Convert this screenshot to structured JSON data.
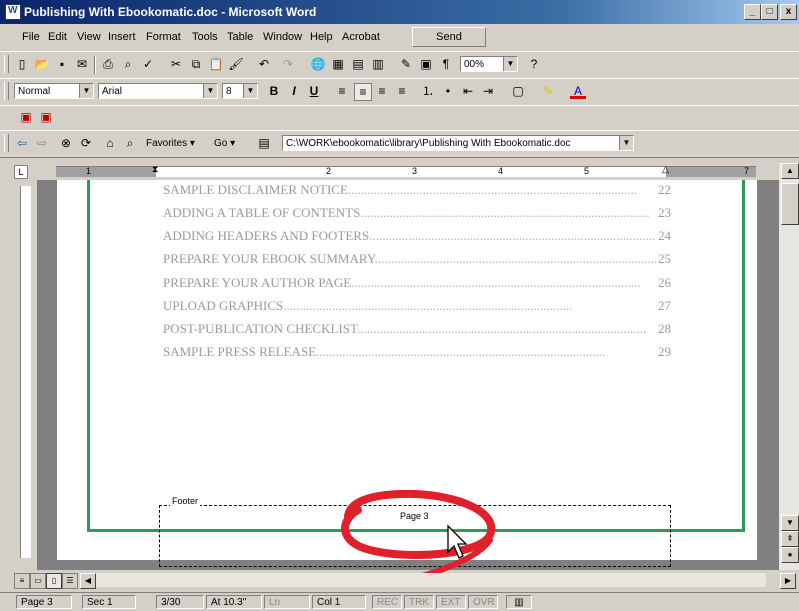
{
  "window": {
    "title": "Publishing With Ebookomatic.doc - Microsoft Word",
    "controls": [
      "_",
      "□",
      "x"
    ]
  },
  "menu": {
    "items": [
      "File",
      "Edit",
      "View",
      "Insert",
      "Format",
      "Tools",
      "Table",
      "Window",
      "Help",
      "Acrobat"
    ],
    "send_label": "Send"
  },
  "toolbar": {
    "zoom": "00%",
    "style": "Normal",
    "font": "Arial",
    "font_size": "8",
    "bold": "B",
    "italic": "I",
    "underline": "U"
  },
  "web_toolbar": {
    "favorites_label": "Favorites",
    "go_label": "Go",
    "address": "C:\\WORK\\ebookomatic\\library\\Publishing With Ebookomatic.doc"
  },
  "ruler": {
    "numbers": [
      "1",
      "2",
      "3",
      "4",
      "5",
      "7"
    ]
  },
  "toc": [
    {
      "title": "SAMPLE DISCLAIMER NOTICE",
      "page": "22"
    },
    {
      "title": "ADDING A TABLE OF CONTENTS",
      "page": "23"
    },
    {
      "title": "ADDING HEADERS AND FOOTERS",
      "page": "24"
    },
    {
      "title": "PREPARE YOUR EBOOK SUMMARY",
      "page": "25"
    },
    {
      "title": "PREPARE YOUR AUTHOR PAGE",
      "page": "26"
    },
    {
      "title": "UPLOAD GRAPHICS",
      "page": "27"
    },
    {
      "title": "POST-PUBLICATION CHECKLIST",
      "page": "28"
    },
    {
      "title": "SAMPLE PRESS RELEASE",
      "page": "29"
    }
  ],
  "footer": {
    "label": "Footer",
    "page_text": "Page 3"
  },
  "status": {
    "page": "Page 3",
    "sec": "Sec 1",
    "pages": "3/30",
    "at": "At 10.3\"",
    "ln": "Ln",
    "col": "Col 1",
    "rec": "REC",
    "trk": "TRK",
    "ext": "EXT",
    "ovr": "OVR"
  },
  "colors": {
    "page_border": "#2d9a5c",
    "annotation": "#e0202a",
    "titlebar": "#0a246a"
  }
}
